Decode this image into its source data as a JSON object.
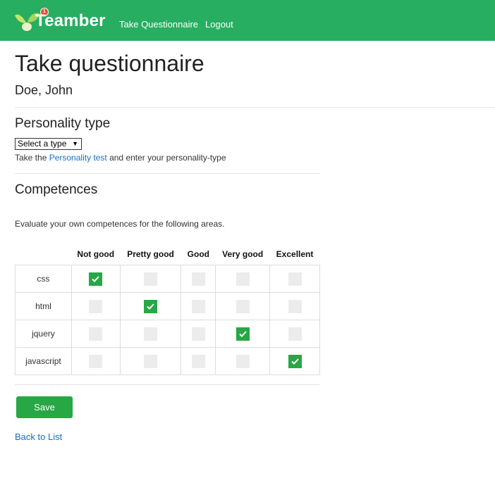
{
  "nav": {
    "brand": "Teamber",
    "badge": "1",
    "links": [
      "Take Questionnaire",
      "Logout"
    ]
  },
  "page": {
    "title": "Take questionnaire",
    "user": "Doe, John"
  },
  "personality": {
    "heading": "Personality type",
    "select_value": "Select a type",
    "hint_before": "Take the ",
    "hint_link": "Personality test",
    "hint_after": " and enter your personality-type"
  },
  "competences": {
    "heading": "Competences",
    "intro": "Evaluate your own competences for the following areas.",
    "columns": [
      "Not good",
      "Pretty good",
      "Good",
      "Very good",
      "Excellent"
    ],
    "rows": [
      {
        "label": "css",
        "selected": 0
      },
      {
        "label": "html",
        "selected": 1
      },
      {
        "label": "jquery",
        "selected": 3
      },
      {
        "label": "javascript",
        "selected": 4
      }
    ]
  },
  "actions": {
    "save_label": "Save",
    "back_label": "Back to List"
  },
  "colors": {
    "navbar": "#27ae60",
    "accent": "#28a745",
    "link": "#1a6fc7"
  }
}
